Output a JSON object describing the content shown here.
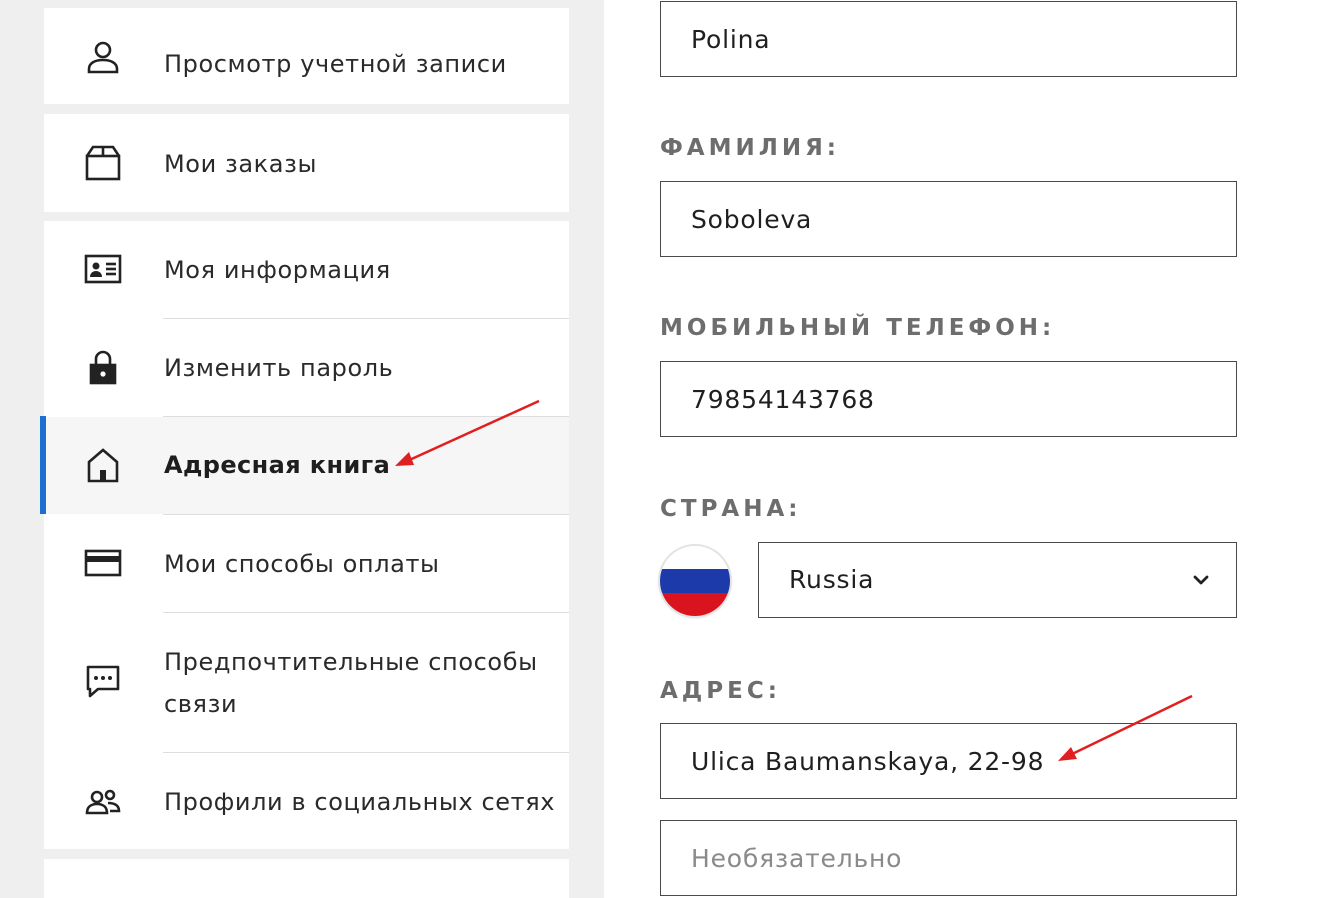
{
  "sidebar": {
    "items": [
      {
        "label": "Просмотр учетной записи",
        "icon": "user-icon"
      },
      {
        "label": "Мои заказы",
        "icon": "box-icon"
      },
      {
        "label": "Моя информация",
        "icon": "id-card-icon"
      },
      {
        "label": "Изменить пароль",
        "icon": "lock-icon"
      },
      {
        "label": "Адресная книга",
        "icon": "home-icon",
        "active": true
      },
      {
        "label": "Мои способы оплаты",
        "icon": "credit-card-icon"
      },
      {
        "label": "Предпочтительные способы связи",
        "icon": "chat-icon"
      },
      {
        "label": "Профили в социальных сетях",
        "icon": "users-icon"
      }
    ],
    "active_color": "#1a6fd1"
  },
  "form": {
    "first_name": {
      "value": "Polina"
    },
    "last_name": {
      "label": "ФАМИЛИЯ:",
      "value": "Soboleva"
    },
    "mobile": {
      "label": "МОБИЛЬНЫЙ ТЕЛЕФОН:",
      "value": "79854143768"
    },
    "country": {
      "label": "СТРАНА:",
      "value": "Russia",
      "flag": "russia-flag-icon"
    },
    "address": {
      "label": "АДРЕС:",
      "line1": "Ulica Baumanskaya, 22-98",
      "line2_placeholder": "Необязательно"
    }
  },
  "annotations": {
    "arrow_color": "#e02020"
  }
}
